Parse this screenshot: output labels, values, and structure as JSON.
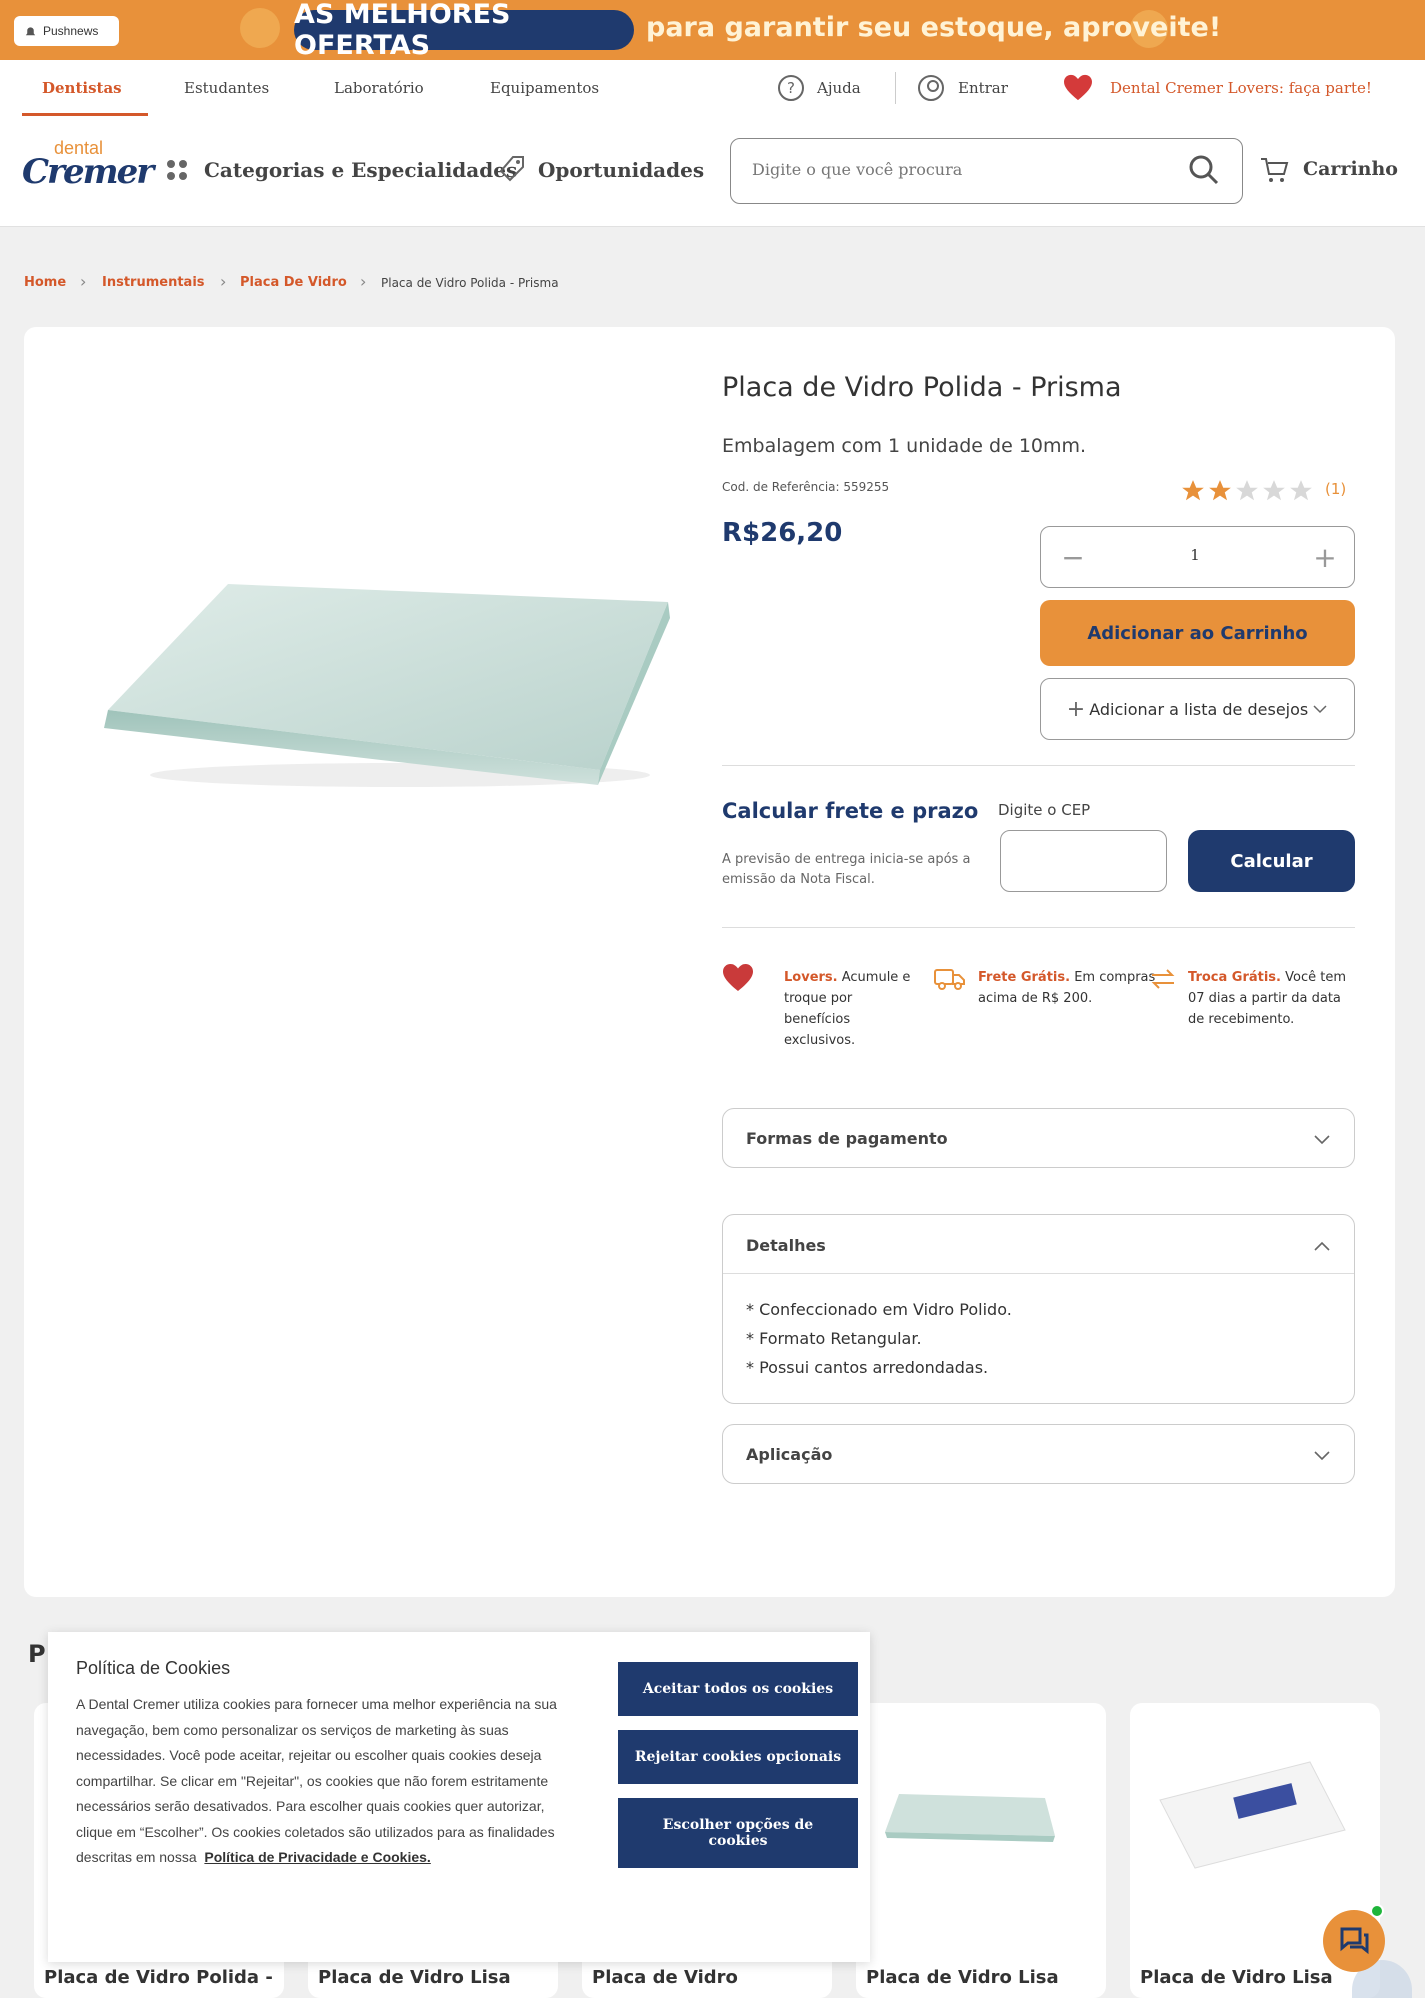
{
  "promo": {
    "pushnews": "Pushnews",
    "pill": "AS MELHORES OFERTAS",
    "text": "para garantir seu estoque, aproveite!"
  },
  "topnav": {
    "tabs": [
      "Dentistas",
      "Estudantes",
      "Laboratório",
      "Equipamentos"
    ],
    "help": "Ajuda",
    "login": "Entrar",
    "lovers": "Dental Cremer Lovers: faça parte!"
  },
  "header": {
    "logo_small": "dental",
    "logo_main": "Cremer",
    "categories": "Categorias e Especialidades",
    "opportunities": "Oportunidades",
    "search_placeholder": "Digite o que você procura",
    "cart": "Carrinho"
  },
  "breadcrumb": [
    "Home",
    "Instrumentais",
    "Placa De Vidro",
    "Placa de Vidro Polida - Prisma"
  ],
  "product": {
    "title": "Placa de Vidro Polida - Prisma",
    "subtitle": "Embalagem com 1 unidade de 10mm.",
    "ref": "Cod. de Referência: 559255",
    "rating": 2,
    "rating_max": 5,
    "rating_count": "(1)",
    "price": "R$26,20",
    "qty": "1",
    "add_to_cart": "Adicionar ao Carrinho",
    "wishlist": "Adicionar a lista de desejos"
  },
  "shipping": {
    "title": "Calcular frete e prazo",
    "cep_label": "Digite o CEP",
    "note": "A previsão de entrega inicia-se após a emissão da Nota Fiscal.",
    "button": "Calcular"
  },
  "benefits": [
    {
      "bold": "Lovers.",
      "text": "Acumule e troque por benefícios exclusivos."
    },
    {
      "bold": "Frete Grátis.",
      "text": "Em compras acima de R$ 200."
    },
    {
      "bold": "Troca Grátis.",
      "text": "Você tem 07 dias a partir da data de recebimento."
    }
  ],
  "accordions": {
    "payment": "Formas de pagamento",
    "details": "Detalhes",
    "application": "Aplicação"
  },
  "details": [
    "* Confeccionado em Vidro Polido.",
    "* Formato Retangular.",
    "* Possui cantos arredondadas."
  ],
  "related": {
    "title_initial": "P",
    "items": [
      "Placa de Vidro Polida -",
      "Placa de Vidro Lisa",
      "Placa de Vidro",
      "Placa de Vidro Lisa",
      "Placa de Vidro Lisa"
    ]
  },
  "cookies": {
    "title": "Política de Cookies",
    "text": "A Dental Cremer utiliza cookies para fornecer uma melhor experiência na sua navegação, bem como personalizar os serviços de marketing às suas necessidades. Você pode aceitar, rejeitar ou escolher quais cookies deseja compartilhar. Se clicar em \"Rejeitar\", os cookies que não forem estritamente necessários serão desativados. Para escolher quais cookies quer autorizar, clique em “Escolher”. Os cookies coletados são utilizados para as finalidades descritas em nossa",
    "link": "Política de Privacidade e Cookies.",
    "accept": "Aceitar todos os cookies",
    "reject": "Rejeitar cookies opcionais",
    "choose": "Escolher opções de cookies"
  },
  "colors": {
    "orange": "#e8913a",
    "navy": "#1f3a6e",
    "accent_red": "#d4582a"
  }
}
